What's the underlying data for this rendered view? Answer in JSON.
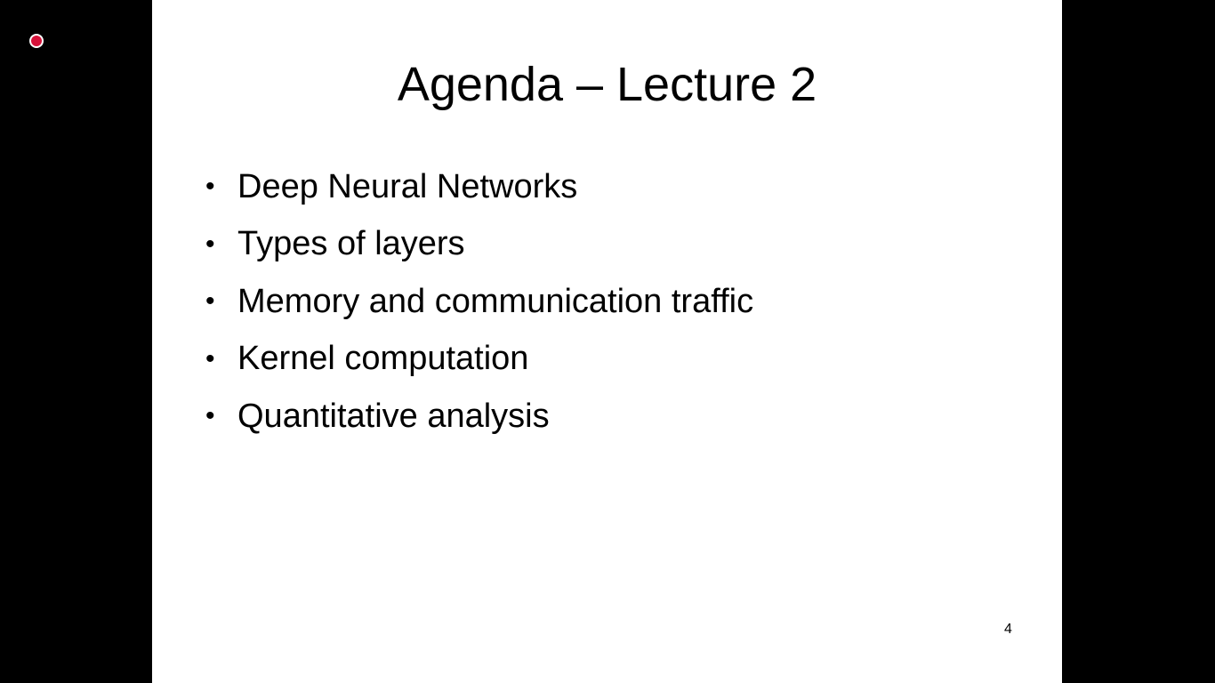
{
  "slide": {
    "title": "Agenda – Lecture 2",
    "bullet_symbol": "•",
    "items": [
      {
        "label": "Deep Neural Networks"
      },
      {
        "label": "Types of layers"
      },
      {
        "label": "Memory and communication traffic"
      },
      {
        "label": "Kernel computation"
      },
      {
        "label": "Quantitative analysis"
      }
    ],
    "page_number": "4"
  },
  "icons": {
    "record_indicator": "record-icon"
  },
  "colors": {
    "background": "#000000",
    "slide_background": "#ffffff",
    "record_indicator": "#d6123a",
    "text": "#000000"
  }
}
